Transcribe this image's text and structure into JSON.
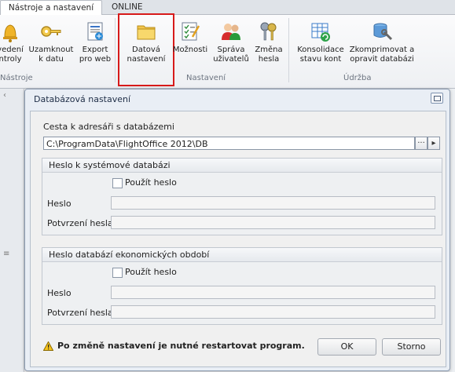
{
  "tabs": {
    "active": "Nástroje a nastavení",
    "inactive": "ONLINE"
  },
  "ribbon": {
    "buttons": [
      {
        "label": "vedení\nntroly",
        "icon": "bell-icon"
      },
      {
        "label": "Uzamknout\nk datu",
        "icon": "key-icon"
      },
      {
        "label": "Export\npro web",
        "icon": "web-export-icon"
      },
      {
        "label": "Datová\nnastavení",
        "icon": "folder-database-icon",
        "selected": true
      },
      {
        "label": "Možnosti",
        "icon": "checklist-icon"
      },
      {
        "label": "Správa\nuživatelů",
        "icon": "users-icon"
      },
      {
        "label": "Změna\nhesla",
        "icon": "keys-icon"
      },
      {
        "label": "Konsolidace\nstavu kont",
        "icon": "table-refresh-icon"
      },
      {
        "label": "Zkomprimovat a\nopravit databázi",
        "icon": "database-repair-icon"
      }
    ],
    "groups": {
      "tools": "Nástroje",
      "settings": "Nastavení",
      "maintenance": "Údržba"
    }
  },
  "dialog": {
    "title": "Databázová nastavení",
    "path_label": "Cesta k adresáři s databázemi",
    "path_value": "C:\\ProgramData\\FlightOffice 2012\\DB",
    "path_browse": "···",
    "path_arrow": "▸",
    "system_group": {
      "title": "Heslo k systémové databázi",
      "use_password": "Použít heslo",
      "password_label": "Heslo",
      "confirm_label": "Potvrzení hesla"
    },
    "period_group": {
      "title": "Heslo databází ekonomických období",
      "use_password": "Použít heslo",
      "password_label": "Heslo",
      "confirm_label": "Potvrzení hesla"
    },
    "warning": "Po změně nastavení je nutné restartovat program.",
    "ok": "OK",
    "cancel": "Storno"
  },
  "background": {
    "left_markers": "‹",
    "left_lines": "≡"
  }
}
